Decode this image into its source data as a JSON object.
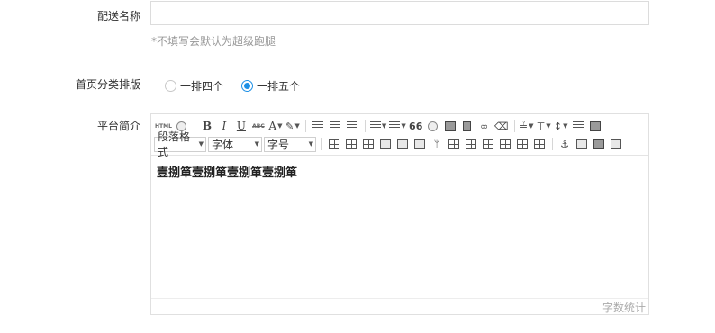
{
  "form": {
    "delivery_name": {
      "label": "配送名称",
      "value": "",
      "placeholder": "",
      "hint": "*不填写会默认为超级跑腿"
    },
    "home_layout": {
      "label": "首页分类排版",
      "options": [
        {
          "label": "一排四个",
          "checked": false
        },
        {
          "label": "一排五个",
          "checked": true
        }
      ]
    },
    "platform_intro": {
      "label": "平台简介",
      "content": "壹捌箪壹捌箪壹捌箪壹捌箪",
      "word_count_label": "字数统计"
    }
  },
  "editor_toolbar": {
    "row1": {
      "html_label": "HTML",
      "bold": "B",
      "italic": "I",
      "underline": "U",
      "strike": "ABC",
      "font_color": "A",
      "quote": "66"
    },
    "row2": {
      "paragraph_select": "段落格式",
      "font_select": "字体",
      "size_select": "字号"
    }
  },
  "colors": {
    "accent": "#1e90e6",
    "border": "#dcdcdc",
    "hint": "#999999"
  }
}
